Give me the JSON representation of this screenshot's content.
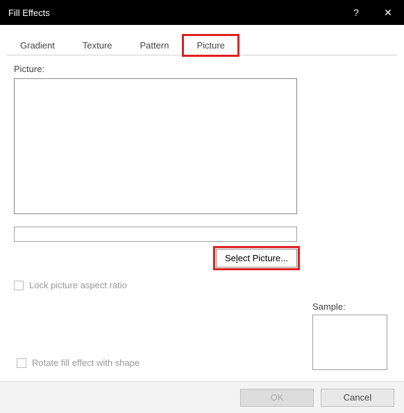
{
  "titlebar": {
    "title": "Fill Effects",
    "help": "?",
    "close": "✕"
  },
  "tabs": [
    {
      "label": "Gradient",
      "active": false
    },
    {
      "label": "Texture",
      "active": false
    },
    {
      "label": "Pattern",
      "active": false
    },
    {
      "label": "Picture",
      "active": true,
      "highlighted": true
    }
  ],
  "picture": {
    "label": "Picture:",
    "name_value": "",
    "select_button_prefix": "Se",
    "select_button_underline": "l",
    "select_button_suffix": "ect Picture...",
    "lock_aspect_label": "Lock picture aspect ratio",
    "lock_aspect_checked": false
  },
  "sample": {
    "label": "Sample:"
  },
  "rotate": {
    "label": "Rotate fill effect with shape",
    "checked": false
  },
  "buttons": {
    "ok": "OK",
    "ok_enabled": false,
    "cancel": "Cancel"
  }
}
